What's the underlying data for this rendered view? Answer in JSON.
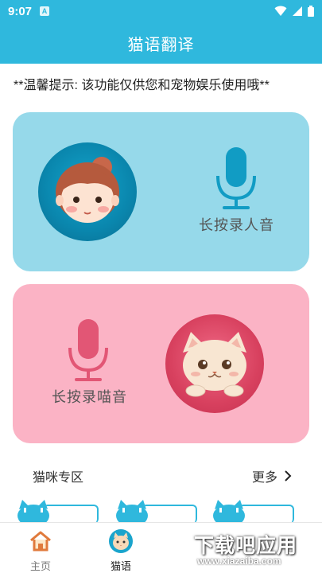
{
  "status_bar": {
    "time": "9:07",
    "notification_letter": "A"
  },
  "header": {
    "title": "猫语翻译"
  },
  "tip": {
    "text": "**温馨提示: 该功能仅供您和宠物娱乐使用哦**"
  },
  "human_card": {
    "label": "长按录人音",
    "avatar_icon": "girl-avatar-icon",
    "mic_icon": "microphone-icon"
  },
  "cat_card": {
    "label": "长按录喵音",
    "avatar_icon": "cat-avatar-icon",
    "mic_icon": "microphone-icon"
  },
  "cat_zone": {
    "title": "猫咪专区",
    "more_label": "更多"
  },
  "bottom_nav": {
    "items": [
      {
        "label": "主页",
        "icon": "home-icon"
      },
      {
        "label": "猫语",
        "icon": "cat-face-icon"
      }
    ]
  },
  "watermark": {
    "main": "下载吧应用",
    "sub": "www.xiazaiba.com"
  },
  "colors": {
    "primary": "#2fb8dd",
    "human_card_bg": "#96d9ea",
    "cat_card_bg": "#fbb3c5",
    "mic_human": "#119cc4",
    "mic_cat": "#e25675"
  }
}
